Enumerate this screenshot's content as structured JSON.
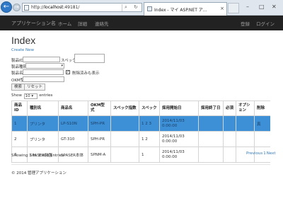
{
  "browser": {
    "url_prefix": "http://",
    "url_host": "localhost",
    "url_port": ":49181/",
    "tab_title": "Index - マイ ASP.NET ア...",
    "tab_close": "×",
    "back_glyph": "←",
    "forward_glyph": "→",
    "search_glyph": "⌕",
    "reload_glyph": "↻",
    "min_glyph": "–",
    "max_glyph": "□",
    "close_glyph": "✕"
  },
  "navbar": {
    "brand": "アプリケーション名",
    "links": [
      "ホーム",
      "詳細",
      "連絡先"
    ],
    "register": "登録",
    "login": "ログイン"
  },
  "page": {
    "title": "Index",
    "create_link": "Create New"
  },
  "filters": {
    "product_id_label": "製品ID",
    "spec_label": "スペック",
    "product_type_label": "製品種別",
    "product_name_label": "製品名",
    "include_deleted_label": "削除済みも表示",
    "include_deleted_checked": true,
    "check_glyph": "✓",
    "okm_label": "OKM型式",
    "search_button": "検索",
    "reset_button": "リセット",
    "select_arrow": "▾"
  },
  "show_entries": {
    "prefix": "Show",
    "value": "10",
    "suffix": "entries"
  },
  "table": {
    "headers": [
      "商品ID",
      "種別名",
      "商品名",
      "OKM型式",
      "スペック指数",
      "スペック",
      "採用開始日",
      "採用終了日",
      "必須",
      "オプション",
      "削除"
    ],
    "rows": [
      [
        "1",
        "プリンタ",
        "LP-S10N",
        "SPH-PR",
        "",
        "1 2 3",
        "2014/11/03 0:00:00",
        "",
        "",
        "",
        "真"
      ],
      [
        "2",
        "プリンタ",
        "GT-310",
        "SPH-PR",
        "",
        "1 2",
        "2014/11/03 0:00:00",
        "",
        "",
        "",
        ""
      ],
      [
        "3",
        "SPASER装置",
        "SPASER本体",
        "SPNM-A",
        "",
        "1",
        "2014/11/03 0:00:00",
        "",
        "",
        "",
        ""
      ]
    ],
    "selected_row": 0
  },
  "pagination": {
    "info": "Showing 1 to 3 of 3 entries",
    "previous": "Previous",
    "current": "1",
    "next": "Next"
  },
  "footer": {
    "text": "© 2014 管理アプリケーション"
  },
  "colors": {
    "navbar_bg": "#222222",
    "link": "#337ab7",
    "selected_row": "#3d8fd6"
  }
}
